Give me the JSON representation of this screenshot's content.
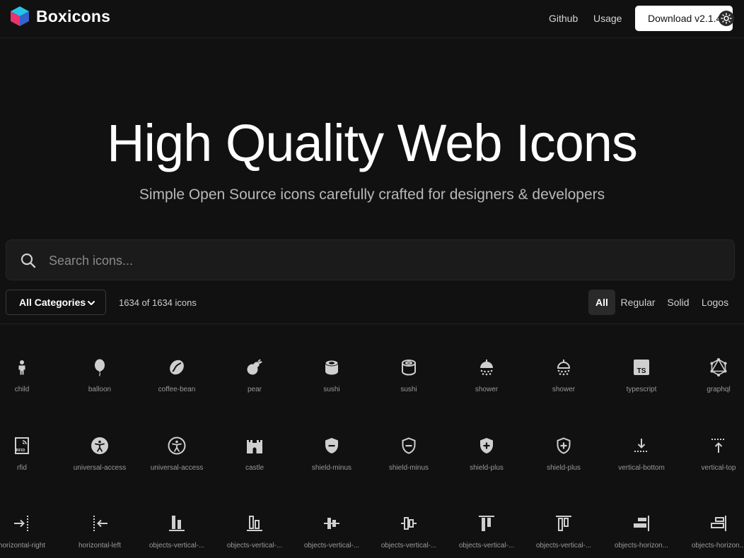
{
  "brand": {
    "name": "Boxicons",
    "colors": {
      "cyan": "#22c4e8",
      "pink": "#e8336c",
      "blue": "#3463c9"
    }
  },
  "nav": {
    "github": "Github",
    "usage": "Usage",
    "download": "Download v2.1.4"
  },
  "hero": {
    "title": "High Quality Web Icons",
    "subtitle": "Simple Open Source icons carefully crafted for designers & developers"
  },
  "search": {
    "placeholder": "Search icons..."
  },
  "filters": {
    "category": "All Categories",
    "count": "1634 of 1634 icons",
    "tabs": [
      "All",
      "Regular",
      "Solid",
      "Logos"
    ],
    "active_tab": "All"
  },
  "icons": [
    {
      "label": "child",
      "icon": "child-icon"
    },
    {
      "label": "balloon",
      "icon": "balloon-icon"
    },
    {
      "label": "coffee-bean",
      "icon": "coffee-bean-icon"
    },
    {
      "label": "pear",
      "icon": "pear-icon"
    },
    {
      "label": "sushi",
      "icon": "sushi-solid-icon"
    },
    {
      "label": "sushi",
      "icon": "sushi-regular-icon"
    },
    {
      "label": "shower",
      "icon": "shower-solid-icon"
    },
    {
      "label": "shower",
      "icon": "shower-regular-icon"
    },
    {
      "label": "typescript",
      "icon": "typescript-icon"
    },
    {
      "label": "graphql",
      "icon": "graphql-icon"
    },
    {
      "label": "rfid",
      "icon": "rfid-icon"
    },
    {
      "label": "universal-access",
      "icon": "universal-access-solid-icon"
    },
    {
      "label": "universal-access",
      "icon": "universal-access-regular-icon"
    },
    {
      "label": "castle",
      "icon": "castle-icon"
    },
    {
      "label": "shield-minus",
      "icon": "shield-minus-solid-icon"
    },
    {
      "label": "shield-minus",
      "icon": "shield-minus-regular-icon"
    },
    {
      "label": "shield-plus",
      "icon": "shield-plus-solid-icon"
    },
    {
      "label": "shield-plus",
      "icon": "shield-plus-regular-icon"
    },
    {
      "label": "vertical-bottom",
      "icon": "vertical-bottom-icon"
    },
    {
      "label": "vertical-top",
      "icon": "vertical-top-icon"
    },
    {
      "label": "horizontal-right",
      "icon": "horizontal-right-icon"
    },
    {
      "label": "horizontal-left",
      "icon": "horizontal-left-icon"
    },
    {
      "label": "objects-vertical-...",
      "icon": "objects-vertical-bottom-solid-icon"
    },
    {
      "label": "objects-vertical-...",
      "icon": "objects-vertical-bottom-regular-icon"
    },
    {
      "label": "objects-vertical-...",
      "icon": "objects-vertical-center-solid-icon"
    },
    {
      "label": "objects-vertical-...",
      "icon": "objects-vertical-center-regular-icon"
    },
    {
      "label": "objects-vertical-...",
      "icon": "objects-vertical-top-solid-icon"
    },
    {
      "label": "objects-vertical-...",
      "icon": "objects-vertical-top-regular-icon"
    },
    {
      "label": "objects-horizon...",
      "icon": "objects-horizontal-right-solid-icon"
    },
    {
      "label": "objects-horizon...",
      "icon": "objects-horizontal-right-regular-icon"
    }
  ]
}
